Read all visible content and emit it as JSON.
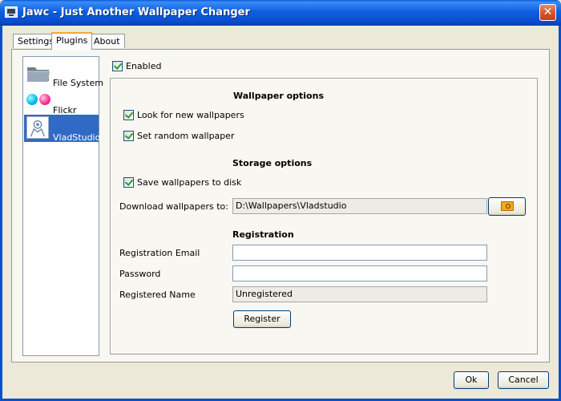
{
  "window": {
    "title": "Jawc - Just Another Wallpaper Changer",
    "close_glyph": "✕",
    "icon": "monitor-icon"
  },
  "tabs": [
    {
      "label": "Settings",
      "active": false
    },
    {
      "label": "Plugins",
      "active": true
    },
    {
      "label": "About",
      "active": false
    }
  ],
  "plugins": {
    "items": [
      {
        "label": "File System",
        "icon": "folder-icon",
        "selected": false
      },
      {
        "label": "Flickr",
        "icon": "flickr-icon",
        "selected": false
      },
      {
        "label": "VladStudio",
        "icon": "vladstudio-icon",
        "selected": true
      }
    ]
  },
  "plugin_settings": {
    "enabled_label": "Enabled",
    "enabled": true,
    "wallpaper_options": {
      "title": "Wallpaper options",
      "look_for_new_label": "Look for new wallpapers",
      "look_for_new": true,
      "random_label": "Set random wallpaper",
      "random": true
    },
    "storage_options": {
      "title": "Storage options",
      "save_label": "Save wallpapers to disk",
      "save": true,
      "download_label": "Download wallpapers to:",
      "download_path": "D:\\Wallpapers\\Vladstudio"
    },
    "registration": {
      "title": "Registration",
      "email_label": "Registration Email",
      "email_value": "",
      "password_label": "Password",
      "password_value": "",
      "name_label": "Registered Name",
      "name_value": "Unregistered",
      "register_button": "Register"
    }
  },
  "footer": {
    "ok_label": "Ok",
    "cancel_label": "Cancel"
  },
  "colors": {
    "titlebar": "#0a5bd6",
    "selection": "#316ac5",
    "dialog_bg": "#ece9d8",
    "checkmark": "#21a121",
    "flickr_blue": "#0063dc",
    "flickr_pink": "#ff0084"
  }
}
